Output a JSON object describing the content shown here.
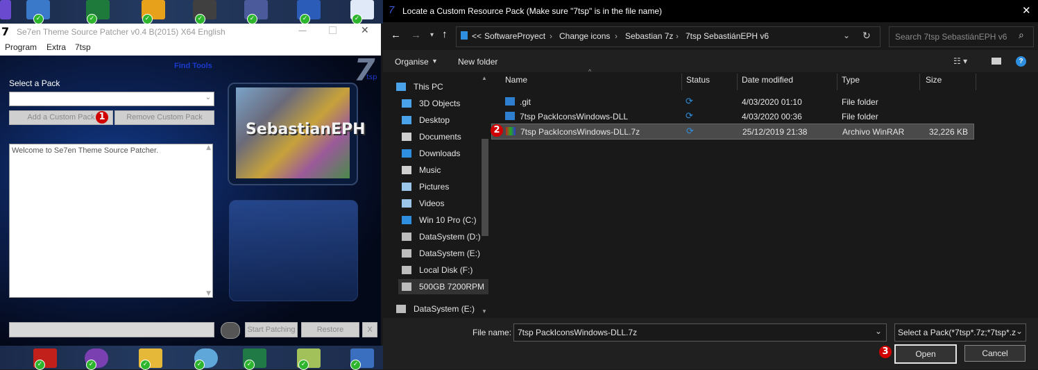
{
  "patcher": {
    "title": "Se7en Theme Source Patcher v0.4 B(2015) X64 English",
    "logo": "7",
    "menu": [
      "Program",
      "Extra",
      "7tsp"
    ],
    "find_tools": "Find Tools",
    "brand": "7",
    "brand_sub": "tsp",
    "select_pack_label": "Select a Pack",
    "add_pack": "Add a Custom Pack",
    "remove_pack": "Remove Custom Pack",
    "log_text": "Welcome to Se7en Theme Source Patcher.",
    "preview_text": "SebastianEPH",
    "start_patching": "Start Patching",
    "restore": "Restore",
    "close_x": "X"
  },
  "dialog": {
    "title": "Locate a Custom Resource Pack (Make sure \"7tsp\" is in the file name)",
    "breadcrumb_prefix": "<<",
    "breadcrumb": [
      "SoftwareProyect",
      "Change icons",
      "Sebastian 7z",
      "7tsp SebastiánEPH v6"
    ],
    "search_placeholder": "Search 7tsp SebastiánEPH v6",
    "toolbar": {
      "organise": "Organise",
      "new_folder": "New folder"
    },
    "nav_root": "This PC",
    "nav": [
      {
        "label": "3D Objects",
        "icon": "3d-objects-icon",
        "color": "#4aa3e8"
      },
      {
        "label": "Desktop",
        "icon": "desktop-icon",
        "color": "#4aa3e8"
      },
      {
        "label": "Documents",
        "icon": "documents-icon",
        "color": "#cfcfcf"
      },
      {
        "label": "Downloads",
        "icon": "downloads-icon",
        "color": "#2e8fe0"
      },
      {
        "label": "Music",
        "icon": "music-icon",
        "color": "#cfcfcf"
      },
      {
        "label": "Pictures",
        "icon": "pictures-icon",
        "color": "#9bc6ea"
      },
      {
        "label": "Videos",
        "icon": "videos-icon",
        "color": "#9bc6ea"
      },
      {
        "label": "Win 10 Pro (C:)",
        "icon": "windows-drive-icon",
        "color": "#2e8fe0"
      },
      {
        "label": "DataSystem (D:)",
        "icon": "drive-icon",
        "color": "#bdbdbd"
      },
      {
        "label": "DataSystem (E:)",
        "icon": "drive-icon",
        "color": "#bdbdbd"
      },
      {
        "label": "Local Disk (F:)",
        "icon": "drive-icon",
        "color": "#bdbdbd"
      },
      {
        "label": "500GB 7200RPM",
        "icon": "drive-icon",
        "color": "#bdbdbd"
      }
    ],
    "nav_bottom": "DataSystem (E:)",
    "columns": [
      "Name",
      "Status",
      "Date modified",
      "Type",
      "Size"
    ],
    "files": [
      {
        "name": ".git",
        "icon": "folder-icon",
        "date": "4/03/2020 01:10",
        "type": "File folder",
        "size": ""
      },
      {
        "name": "7tsp PackIconsWindows-DLL",
        "icon": "folder-icon",
        "date": "4/03/2020 00:36",
        "type": "File folder",
        "size": ""
      },
      {
        "name": "7tsp PackIconsWindows-DLL.7z",
        "icon": "winrar-archive-icon",
        "date": "25/12/2019 21:38",
        "type": "Archivo WinRAR",
        "size": "32,226 KB"
      }
    ],
    "filename_label": "File name:",
    "filename_value": "7tsp PackIconsWindows-DLL.7z",
    "filter_value": "Select a Pack(*7tsp*.7z;*7tsp*.zi",
    "open": "Open",
    "cancel": "Cancel"
  },
  "badges": [
    "1",
    "2",
    "3"
  ],
  "colors": {
    "badge": "#d10000",
    "accent": "#2e8fe0",
    "selected_row": "#4a4a4a"
  }
}
